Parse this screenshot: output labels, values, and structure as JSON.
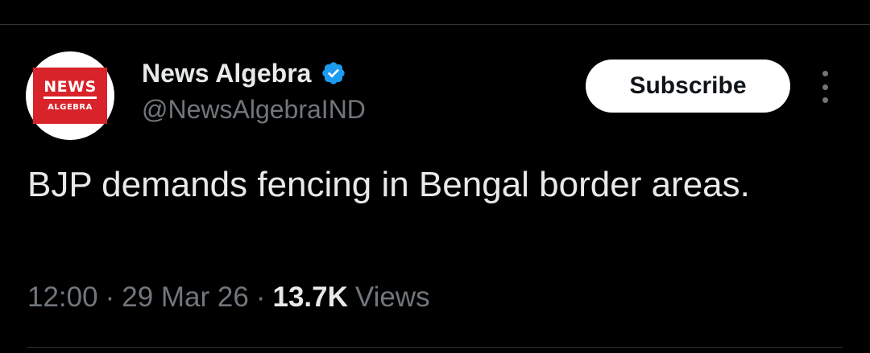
{
  "author": {
    "display_name": "News Algebra",
    "handle": "@NewsAlgebraIND",
    "verified": true,
    "avatar_logo_line1": "NEWS",
    "avatar_logo_line2": "ALGEBRA"
  },
  "actions": {
    "subscribe_label": "Subscribe",
    "more_icon": "more-vertical-icon"
  },
  "tweet": {
    "text": "BJP demands fencing in Bengal border areas.",
    "time": "12:00",
    "separator": "·",
    "date": "29 Mar 26",
    "views_count": "13.7K",
    "views_label": "Views"
  },
  "colors": {
    "background": "#000000",
    "text_primary": "#e7e9ea",
    "text_secondary": "#71767b",
    "verified_badge": "#1d9bf0",
    "logo_red": "#d8232a",
    "divider": "#2f3336"
  }
}
